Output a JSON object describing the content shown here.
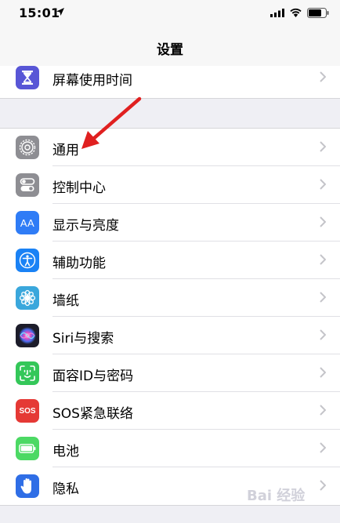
{
  "status_bar": {
    "time": "15:01"
  },
  "nav": {
    "title": "设置"
  },
  "screen_time": {
    "label": "屏幕使用时间",
    "icon": "hourglass-icon",
    "color": "#5856d6"
  },
  "settings": [
    {
      "label": "通用",
      "icon": "gear-icon",
      "color": "#8e8e93"
    },
    {
      "label": "控制中心",
      "icon": "toggles-icon",
      "color": "#8e8e93"
    },
    {
      "label": "显示与亮度",
      "icon": "text-size-icon",
      "color": "#2f7cf6",
      "glyph": "AA"
    },
    {
      "label": "辅助功能",
      "icon": "accessibility-icon",
      "color": "#1a82f5"
    },
    {
      "label": "墙纸",
      "icon": "flower-icon",
      "color": "#3aa7dc"
    },
    {
      "label": "Siri与搜索",
      "icon": "siri-icon",
      "color": "#2b2b3a"
    },
    {
      "label": "面容ID与密码",
      "icon": "face-id-icon",
      "color": "#34c759"
    },
    {
      "label": "SOS紧急联络",
      "icon": "sos-icon",
      "color": "#e53935",
      "glyph": "SOS"
    },
    {
      "label": "电池",
      "icon": "battery-icon",
      "color": "#4cd964"
    },
    {
      "label": "隐私",
      "icon": "hand-icon",
      "color": "#2f6ee6"
    }
  ],
  "annotation": {
    "color": "#e02020"
  },
  "watermark": {
    "text": "Bai 经验"
  }
}
